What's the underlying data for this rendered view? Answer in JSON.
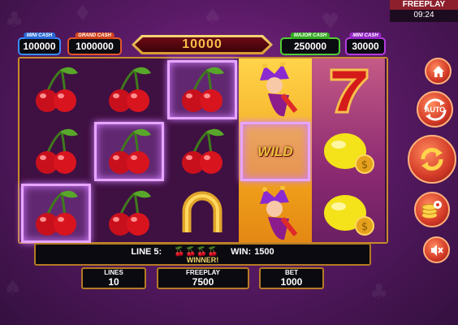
{
  "status": {
    "mode_label": "FREEPLAY",
    "clock": "09:24"
  },
  "jackpots": {
    "mini": {
      "label": "MINI CASH",
      "value": "100000"
    },
    "grand": {
      "label": "GRAND CASH",
      "value": "1000000"
    },
    "main": {
      "value": "10000"
    },
    "major": {
      "label": "MAJOR CASH",
      "value": "250000"
    },
    "minor": {
      "label": "MINI CASH",
      "value": "30000"
    }
  },
  "reels": [
    [
      "cherry",
      "cherry",
      "cherry"
    ],
    [
      "cherry",
      "cherry",
      "cherry"
    ],
    [
      "cherry",
      "cherry",
      "horseshoe"
    ],
    [
      "joker",
      "wild",
      "joker"
    ],
    [
      "seven",
      "lemon",
      "lemon"
    ]
  ],
  "winning_cells": [
    [
      0,
      2
    ],
    [
      1,
      1
    ],
    [
      2,
      0
    ],
    [
      3,
      1
    ]
  ],
  "wild_text": "WILD",
  "win": {
    "line_label": "LINE 5:",
    "line_symbols": "🍒🍒🍒🍒",
    "win_label": "WIN:",
    "win_value": "1500",
    "status": "WINNER!"
  },
  "panels": {
    "lines": {
      "label": "LINES",
      "value": "10"
    },
    "freeplay": {
      "label": "FREEPLAY",
      "value": "7500"
    },
    "bet": {
      "label": "BET",
      "value": "1000"
    }
  },
  "buttons": {
    "home": "home-icon",
    "auto_label": "AUTO",
    "spin": "spin-icon",
    "coins": "coins-settings-icon",
    "sound": "mute-icon"
  },
  "colors": {
    "accent_gold": "#f5c04a",
    "frame": "#c98c2c",
    "win_highlight": "#e7a6ff",
    "button_red": "#d33a27"
  }
}
